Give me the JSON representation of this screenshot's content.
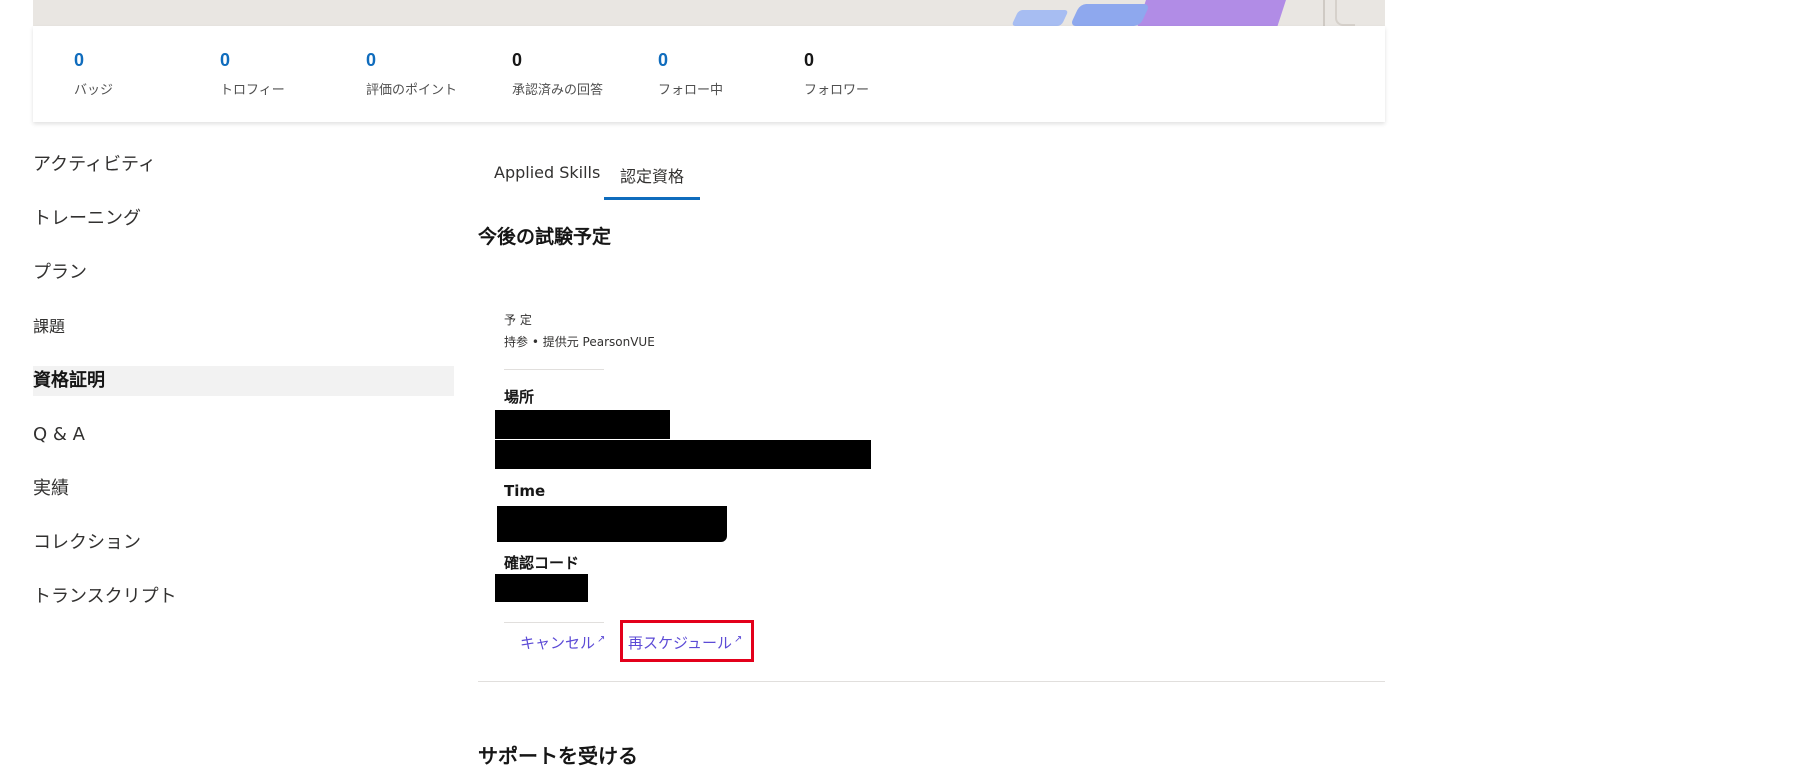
{
  "stats": [
    {
      "value": "0",
      "label": "バッジ",
      "accent": true
    },
    {
      "value": "0",
      "label": "トロフィー",
      "accent": true
    },
    {
      "value": "0",
      "label": "評価のポイント",
      "accent": true
    },
    {
      "value": "0",
      "label": "承認済みの回答",
      "accent": false
    },
    {
      "value": "0",
      "label": "フォロー中",
      "accent": true
    },
    {
      "value": "0",
      "label": "フォロワー",
      "accent": false
    }
  ],
  "sidebar": {
    "items": [
      {
        "label": "アクティビティ"
      },
      {
        "label": "トレーニング"
      },
      {
        "label": "プラン"
      },
      {
        "label": "課題"
      },
      {
        "label": "資格証明",
        "active": true
      },
      {
        "label": "Q & A"
      },
      {
        "label": "実績"
      },
      {
        "label": "コレクション"
      },
      {
        "label": "トランスクリプト"
      }
    ]
  },
  "tabs": {
    "applied_skills": "Applied Skills",
    "certifications": "認定資格"
  },
  "main": {
    "heading": "今後の試験予定",
    "status": "予 定",
    "provider": "持参 • 提供元 PearsonVUE",
    "location_label": "場所",
    "time_label": "Time",
    "confirmation_label": "確認コード",
    "cancel_link": "キャンセル",
    "reschedule_link": "再スケジュール",
    "next_heading": "サポートを受ける"
  },
  "colors": {
    "accent": "#0f6cbd",
    "link": "#5c4bd6",
    "highlight": "#e3001b"
  }
}
